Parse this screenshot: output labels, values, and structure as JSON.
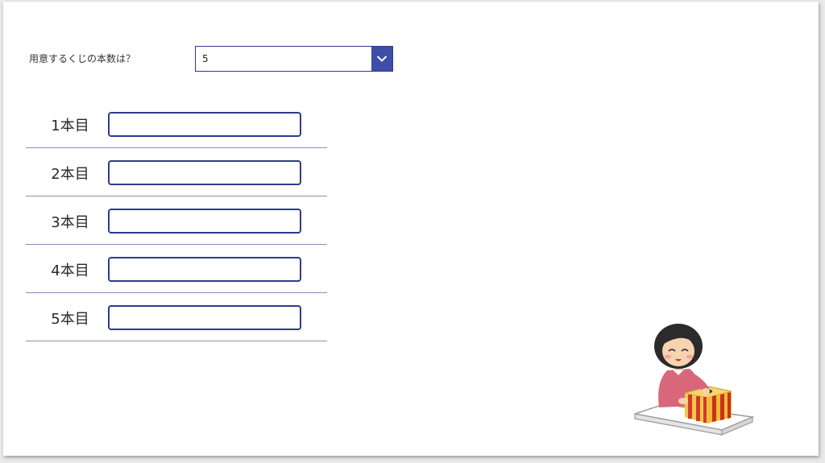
{
  "question": {
    "label": "用意するくじの本数は？"
  },
  "dropdown": {
    "selected": "5",
    "icon": "chevron-down-icon"
  },
  "rows": [
    {
      "label": "1本目",
      "value": ""
    },
    {
      "label": "2本目",
      "value": ""
    },
    {
      "label": "3本目",
      "value": ""
    },
    {
      "label": "4本目",
      "value": ""
    },
    {
      "label": "5本目",
      "value": ""
    }
  ],
  "colors": {
    "accent": "#3c4ea7",
    "border": "#2f3a8f",
    "divider": "#8a8fb5"
  },
  "illustration": {
    "description_icon": "girl-drawing-lottery-box-icon"
  }
}
